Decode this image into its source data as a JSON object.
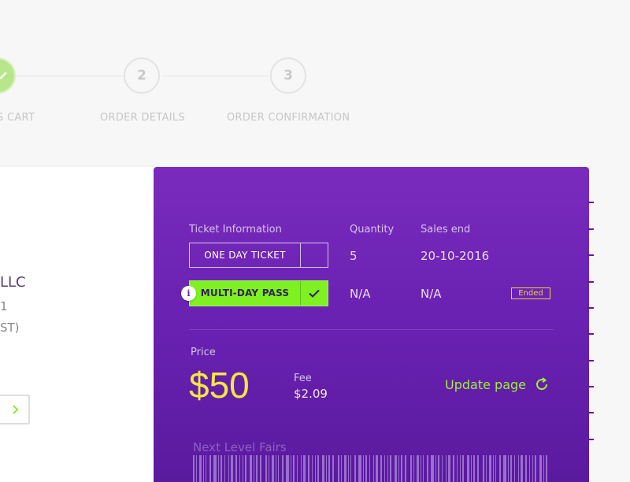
{
  "stepper": {
    "steps": [
      {
        "label": "S CART",
        "number": "",
        "state": "done"
      },
      {
        "label": "ORDER DETAILS",
        "number": "2",
        "state": "pending"
      },
      {
        "label": "ORDER CONFIRMATION",
        "number": "3",
        "state": "pending"
      }
    ]
  },
  "left_card": {
    "company": "LLC",
    "line1": "1",
    "line2": "ST)",
    "next_icon": "chevron-right-icon"
  },
  "ticket": {
    "headers": {
      "info": "Ticket Information",
      "quantity": "Quantity",
      "sales_end": "Sales end"
    },
    "rows": [
      {
        "name": "ONE DAY TICKET",
        "quantity": "5",
        "sales_end": "20-10-2016",
        "selected": false
      },
      {
        "name": "MULTI-DAY PASS",
        "quantity": "N/A",
        "sales_end": "N/A",
        "selected": true,
        "status": "Ended"
      }
    ],
    "price_label": "Price",
    "price": "$50",
    "fee_label": "Fee",
    "fee": "$2.09",
    "update_label": "Update page",
    "brand": "Next Level Fairs",
    "colors": {
      "ticket_bg": "#6a22b3",
      "accent_green": "#7ff021",
      "price_yellow": "#f5e642",
      "ended_badge": "#f1d03a"
    }
  }
}
